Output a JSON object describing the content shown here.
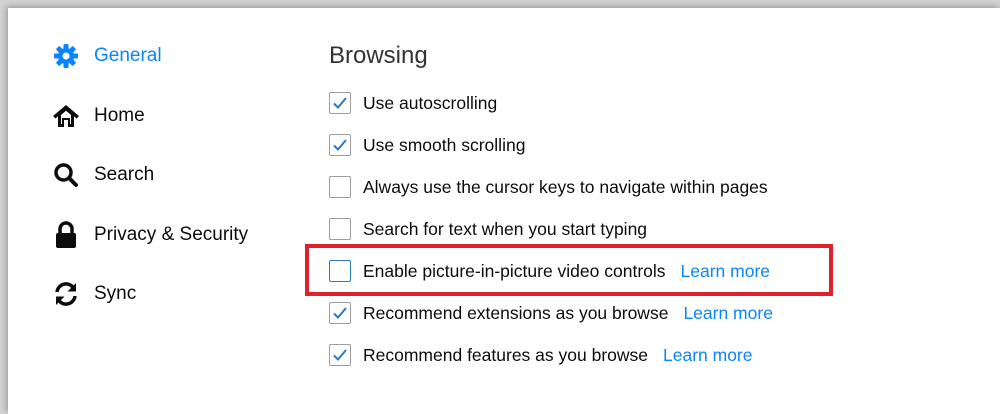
{
  "sidebar": {
    "items": [
      {
        "label": "General",
        "icon": "gear-icon",
        "active": true
      },
      {
        "label": "Home",
        "icon": "home-icon",
        "active": false
      },
      {
        "label": "Search",
        "icon": "search-icon",
        "active": false
      },
      {
        "label": "Privacy & Security",
        "icon": "lock-icon",
        "active": false
      },
      {
        "label": "Sync",
        "icon": "sync-icon",
        "active": false
      }
    ]
  },
  "main": {
    "section_title": "Browsing",
    "options": [
      {
        "label": "Use autoscrolling",
        "checked": true,
        "link": ""
      },
      {
        "label": "Use smooth scrolling",
        "checked": true,
        "link": ""
      },
      {
        "label": "Always use the cursor keys to navigate within pages",
        "checked": false,
        "link": ""
      },
      {
        "label": "Search for text when you start typing",
        "checked": false,
        "link": ""
      },
      {
        "label": "Enable picture-in-picture video controls",
        "checked": false,
        "link": "Learn more"
      },
      {
        "label": "Recommend extensions as you browse",
        "checked": true,
        "link": "Learn more"
      },
      {
        "label": "Recommend features as you browse",
        "checked": true,
        "link": "Learn more"
      }
    ]
  },
  "colors": {
    "accent": "#0a84ff",
    "highlight_border": "#e0202a",
    "text": "#0c0c0d"
  }
}
